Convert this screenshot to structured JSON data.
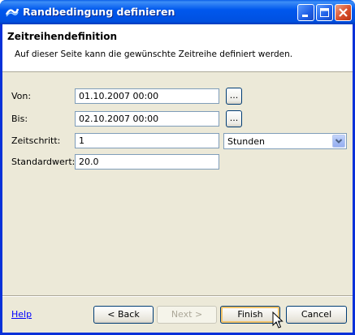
{
  "window": {
    "title": "Randbedingung definieren"
  },
  "header": {
    "title": "Zeitreihendefinition",
    "description": "Auf dieser Seite kann die gewünschte Zeitreihe definiert werden."
  },
  "form": {
    "von": {
      "label": "Von:",
      "value": "01.10.2007 00:00",
      "browse_label": "..."
    },
    "bis": {
      "label": "Bis:",
      "value": "02.10.2007 00:00",
      "browse_label": "..."
    },
    "zeitschritt": {
      "label": "Zeitschritt:",
      "value": "1",
      "unit_selected": "Stunden"
    },
    "standardwert": {
      "label": "Standardwert:",
      "value": "20.0"
    }
  },
  "footer": {
    "help_label": "Help",
    "back_label": "< Back",
    "next_label": "Next >",
    "finish_label": "Finish",
    "cancel_label": "Cancel"
  },
  "icons": {
    "app": "wave-icon",
    "minimize": "minimize-icon",
    "maximize": "maximize-icon",
    "close": "close-icon",
    "dropdown": "chevron-down-icon",
    "cursor": "mouse-cursor-icon"
  },
  "colors": {
    "titlebar": "#0058ee",
    "close_button": "#d9502c",
    "dialog_bg": "#ece9d8",
    "help_link": "#0000ff",
    "default_button_focus": "#f3c46b"
  }
}
